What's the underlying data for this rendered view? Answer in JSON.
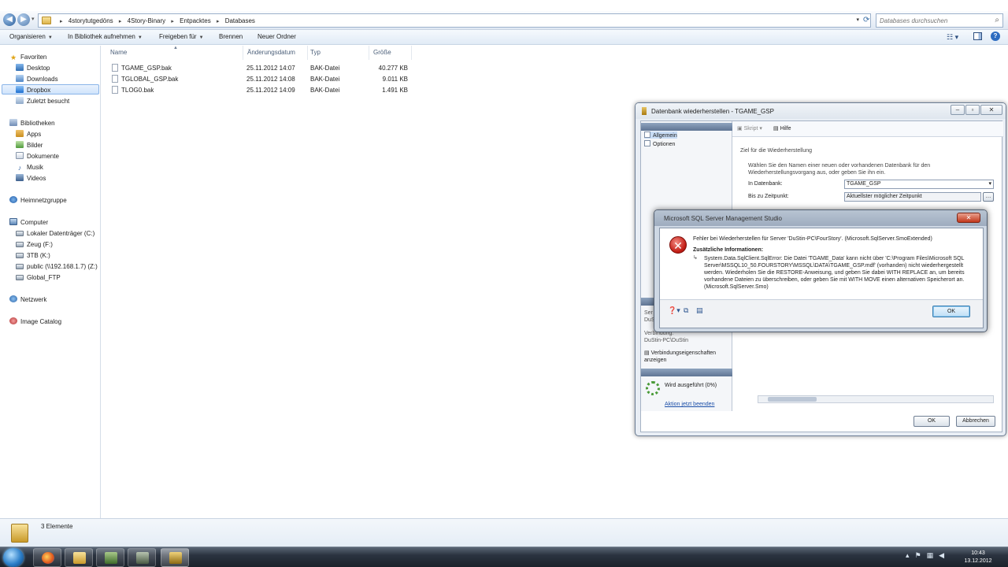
{
  "address_bar": {
    "breadcrumb": [
      "4storytutgedöns",
      "4Story-Binary",
      "Entpacktes",
      "Databases"
    ],
    "search_placeholder": "Databases durchsuchen"
  },
  "toolbar": {
    "organize": "Organisieren",
    "add_to_library": "In Bibliothek aufnehmen",
    "share_with": "Freigeben für",
    "burn": "Brennen",
    "new_folder": "Neuer Ordner"
  },
  "nav": {
    "favorites": "Favoriten",
    "desktop": "Desktop",
    "downloads": "Downloads",
    "dropbox": "Dropbox",
    "recent": "Zuletzt besucht",
    "libraries": "Bibliotheken",
    "apps": "Apps",
    "pictures": "Bilder",
    "documents": "Dokumente",
    "music": "Musik",
    "videos": "Videos",
    "homegroup": "Heimnetzgruppe",
    "computer": "Computer",
    "drive_c": "Lokaler Datenträger (C:)",
    "drive_f": "Zeug (F:)",
    "drive_k": "3TB (K:)",
    "drive_z": "public (\\\\192.168.1.7) (Z:)",
    "global_ftp": "Global_FTP",
    "network": "Netzwerk",
    "image_catalog": "Image Catalog"
  },
  "file_list": {
    "columns": {
      "name": "Name",
      "modified": "Änderungsdatum",
      "type": "Typ",
      "size": "Größe"
    },
    "rows": [
      {
        "name": "TGAME_GSP.bak",
        "modified": "25.11.2012 14:07",
        "type": "BAK-Datei",
        "size": "40.277 KB"
      },
      {
        "name": "TGLOBAL_GSP.bak",
        "modified": "25.11.2012 14:08",
        "type": "BAK-Datei",
        "size": "9.011 KB"
      },
      {
        "name": "TLOG0.bak",
        "modified": "25.11.2012 14:09",
        "type": "BAK-Datei",
        "size": "1.491 KB"
      }
    ]
  },
  "status_bar": {
    "count": "3 Elemente"
  },
  "taskbar": {
    "time": "10:43",
    "date": "13.12.2012"
  },
  "restore_dialog": {
    "title": "Datenbank wiederherstellen - TGAME_GSP",
    "pages": [
      "Allgemein",
      "Optionen"
    ],
    "script_label": "Skript",
    "help_label": "Hilfe",
    "section_title": "Ziel für die Wiederherstellung",
    "instruction": "Wählen Sie den Namen einer neuen oder vorhandenen Datenbank für den Wiederherstellungsvorgang aus, oder geben Sie ihn ein.",
    "to_database_label": "In Datenbank:",
    "to_database_value": "TGAME_GSP",
    "point_in_time_label": "Bis zu Zeitpunkt:",
    "point_in_time_value": "Aktuellster möglicher Zeitpunkt",
    "connection_server_partial": "Ser",
    "connection_server_value_partial": "DuS",
    "connection_label": "Verbindung:",
    "connection_value": "DuStin-PC\\DuStin",
    "view_connection_props": "Verbindungseigenschaften anzeigen",
    "progress_status": "Wird ausgeführt (0%)",
    "stop_action": "Aktion jetzt beenden",
    "ok": "OK",
    "cancel": "Abbrechen"
  },
  "error_dialog": {
    "title": "Microsoft SQL Server Management Studio",
    "main_message": "Fehler bei Wiederherstellen für Server 'DuStin-PC\\FourStory'.  (Microsoft.SqlServer.SmoExtended)",
    "additional_info_label": "Zusätzliche Informationen:",
    "detail": "System.Data.SqlClient.SqlError: Die Datei 'TGAME_Data' kann nicht über 'C:\\Program Files\\Microsoft SQL Server\\MSSQL10_50.FOURSTORY\\MSSQL\\DATA\\TGAME_GSP.mdf' (vorhanden) nicht wiederhergestellt werden. Wiederholen Sie die RESTORE-Anweisung, und geben Sie dabei WITH REPLACE an, um bereits vorhandene Dateien zu überschreiben, oder geben Sie mit WITH MOVE einen alternativen Speicherort an. (Microsoft.SqlServer.Smo)",
    "ok": "OK"
  }
}
